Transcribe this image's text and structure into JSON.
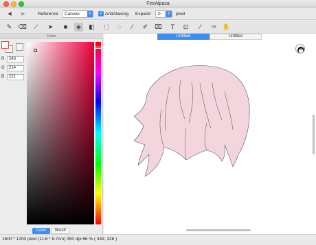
{
  "window": {
    "title": "FireAlpaca"
  },
  "options_bar": {
    "reference_label": "Reference",
    "reference_value": "Canvas",
    "antialiasing_label": "AntiAliasing",
    "antialiasing_checked": true,
    "expand_label": "Expand",
    "expand_value": "0",
    "expand_unit": "pixel"
  },
  "toolbar": {
    "tools": [
      "pen-icon",
      "eraser-icon",
      "dot-pen-icon",
      "move-icon",
      "fill-icon",
      "bucket-icon",
      "gradation-icon",
      "select-icon",
      "lasso-icon",
      "magic-wand-icon",
      "select-pen-icon",
      "select-eraser-icon",
      "text-icon",
      "operation-icon",
      "eyedropper-icon",
      "hand-icon",
      "zoom-icon"
    ],
    "active_tool": "bucket-icon"
  },
  "color_panel": {
    "title": "Color",
    "r_label": "R",
    "r_value": "243",
    "g_label": "G",
    "g_value": "214",
    "b_label": "B",
    "b_value": "221",
    "fill_color": "#f3d6dd",
    "tab_color": "Color",
    "tab_brush": "Brush"
  },
  "documents": {
    "tab_active": "Untitled",
    "tab_inactive": "Untitled"
  },
  "status": {
    "text": "1600 * 1200 pixel   (11.6 * 8.7cm)   350 dpi   66 %   ( 349, 326 )"
  },
  "colors": {
    "accent": "#3d8ef0",
    "hair_fill": "#f3d6dd",
    "hair_stroke": "#555555"
  }
}
